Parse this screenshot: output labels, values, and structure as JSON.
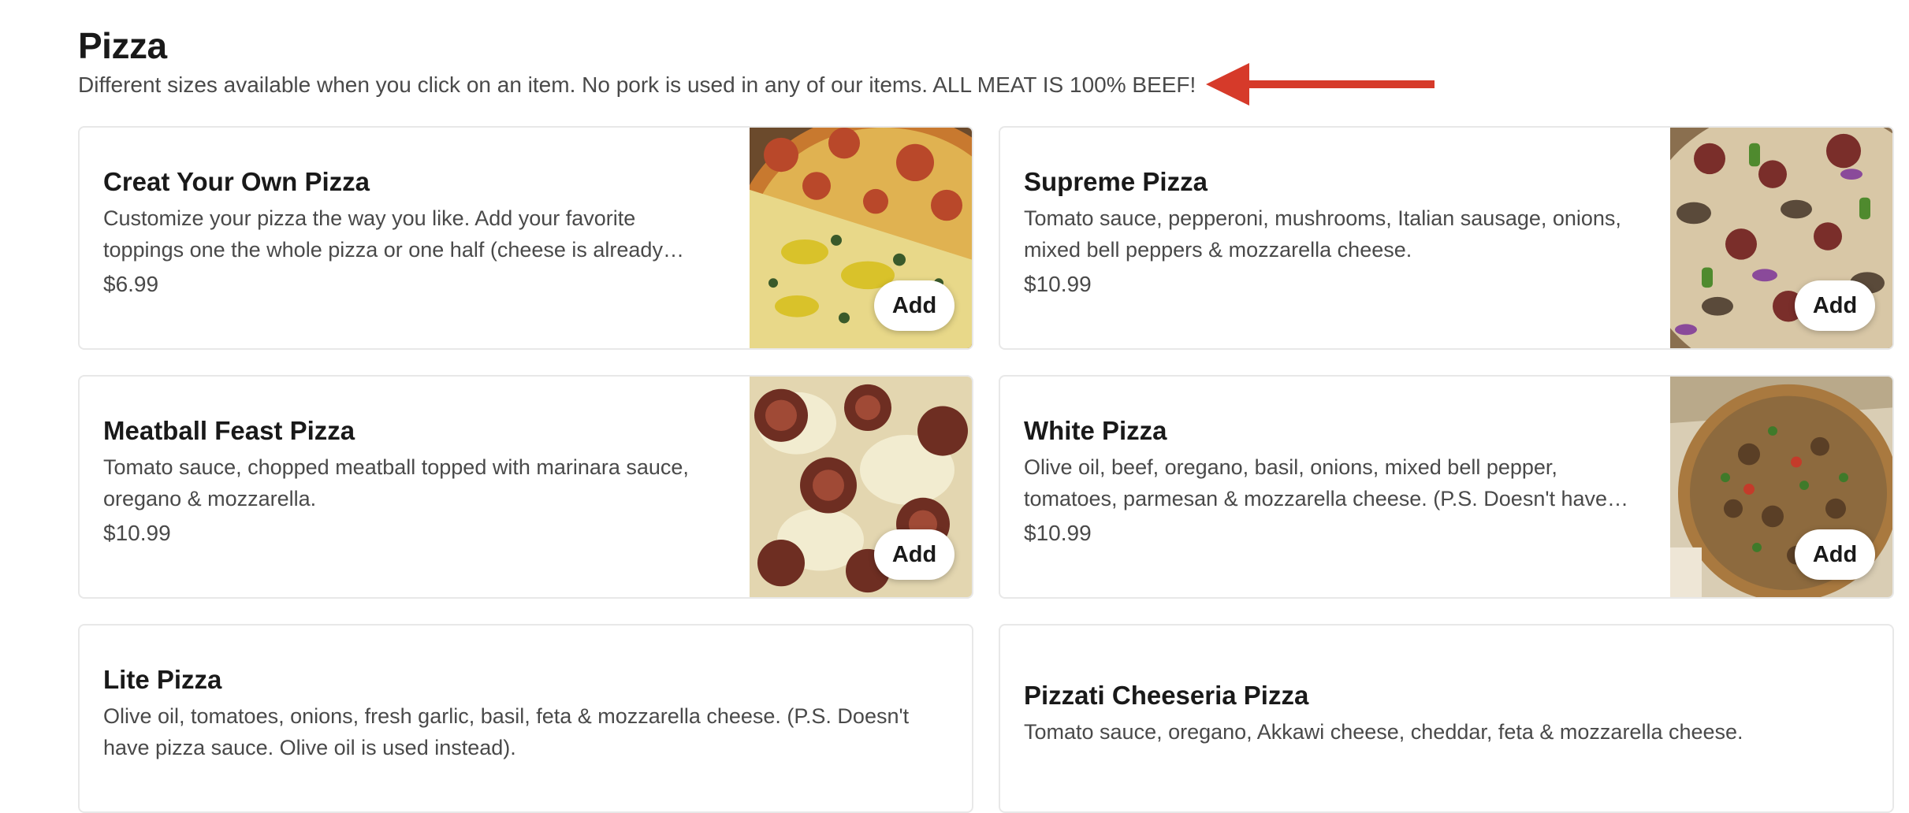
{
  "section": {
    "title": "Pizza",
    "subtitle": "Different sizes available when you click on an item. No pork is used in any of our items. ALL MEAT IS 100% BEEF!"
  },
  "colors": {
    "annotation_arrow": "#d63a2a",
    "card_border": "#e8e8e8"
  },
  "items": [
    {
      "name": "Creat Your Own Pizza",
      "description": "Customize your pizza the way you like. Add your favorite toppings one the whole pizza or one half (cheese is already included)",
      "price": "$6.99",
      "add_label": "Add"
    },
    {
      "name": "Supreme Pizza",
      "description": "Tomato sauce, pepperoni, mushrooms, Italian sausage, onions, mixed bell peppers & mozzarella cheese.",
      "price": "$10.99",
      "add_label": "Add"
    },
    {
      "name": "Meatball Feast Pizza",
      "description": "Tomato sauce, chopped meatball topped with marinara sauce, oregano & mozzarella.",
      "price": "$10.99",
      "add_label": "Add"
    },
    {
      "name": "White Pizza",
      "description": "Olive oil, beef, oregano, basil, onions, mixed bell pepper, tomatoes, parmesan & mozzarella cheese. (P.S. Doesn't have pizza sauce)",
      "price": "$10.99",
      "add_label": "Add"
    },
    {
      "name": "Lite Pizza",
      "description": "Olive oil, tomatoes, onions, fresh garlic, basil, feta & mozzarella cheese. (P.S. Doesn't have pizza sauce. Olive oil is used instead)."
    },
    {
      "name": "Pizzati Cheeseria Pizza",
      "description": "Tomato sauce, oregano, Akkawi cheese, cheddar, feta & mozzarella cheese."
    }
  ]
}
